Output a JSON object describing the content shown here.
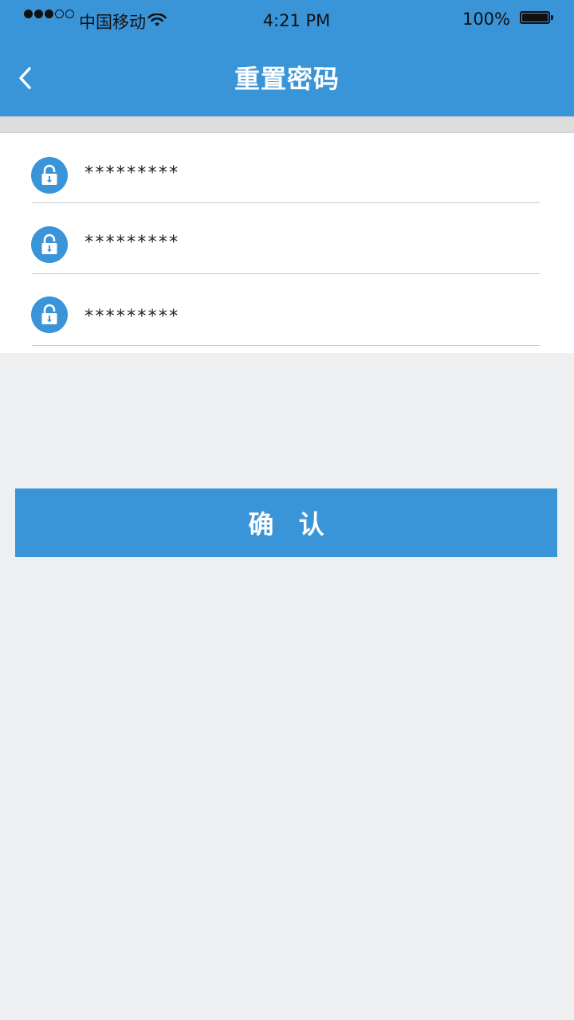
{
  "status_bar": {
    "carrier": "中国移动",
    "time": "4:21 PM",
    "battery": "100%"
  },
  "header": {
    "title": "重置密码",
    "back_icon": "chevron-left-icon"
  },
  "form": {
    "fields": [
      {
        "value": "*********",
        "icon": "lock-icon"
      },
      {
        "value": "*********",
        "icon": "lock-icon"
      },
      {
        "value": "*********",
        "icon": "lock-icon"
      }
    ]
  },
  "actions": {
    "confirm_label": "确 认"
  },
  "colors": {
    "primary": "#3a94d8",
    "background": "#eeeff1",
    "surface": "#ffffff",
    "divider": "#c9c9c9"
  }
}
